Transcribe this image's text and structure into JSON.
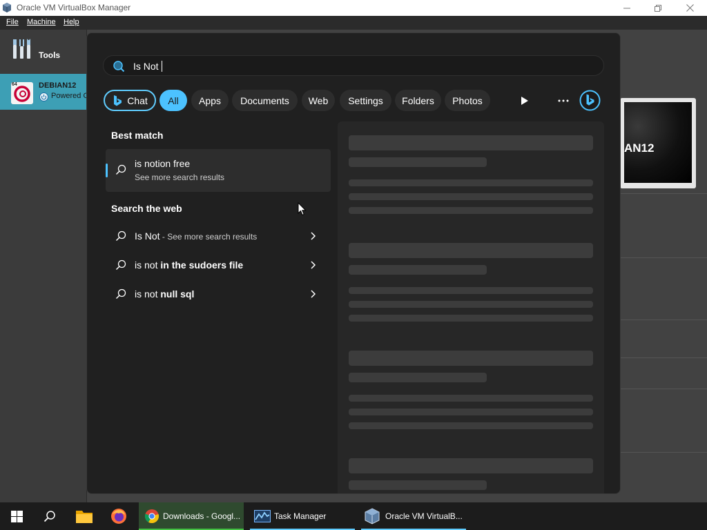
{
  "window": {
    "title": "Oracle VM VirtualBox Manager",
    "menu": [
      "File",
      "Machine",
      "Help"
    ]
  },
  "sidebar": {
    "tools_label": "Tools",
    "vm": {
      "name": "DEBIAN12",
      "state": "Powered Off",
      "badge": "64"
    }
  },
  "preview": {
    "text": "AN12"
  },
  "search": {
    "query": "Is Not",
    "filters": [
      "Chat",
      "All",
      "Apps",
      "Documents",
      "Web",
      "Settings",
      "Folders",
      "Photos"
    ],
    "active_filter": "All",
    "best_match_heading": "Best match",
    "best_match": {
      "title": "is notion free",
      "subtitle": "See more search results"
    },
    "web_heading": "Search the web",
    "web_results": [
      {
        "prefix": "Is Not",
        "bold": "",
        "suffix": " - See more search results"
      },
      {
        "prefix": "is not ",
        "bold": "in the sudoers file",
        "suffix": ""
      },
      {
        "prefix": "is not ",
        "bold": "null sql",
        "suffix": ""
      }
    ]
  },
  "taskbar": {
    "apps": [
      {
        "label": "Downloads - Googl...",
        "icon": "chrome-icon"
      },
      {
        "label": "Task Manager",
        "icon": "task-manager-icon"
      },
      {
        "label": "Oracle VM VirtualB...",
        "icon": "virtualbox-icon"
      }
    ]
  },
  "colors": {
    "accent": "#4cc2ff",
    "panel_bg": "#202020",
    "vm_selected": "#3d9fb5",
    "taskbar_bg": "#1c1c1c"
  }
}
